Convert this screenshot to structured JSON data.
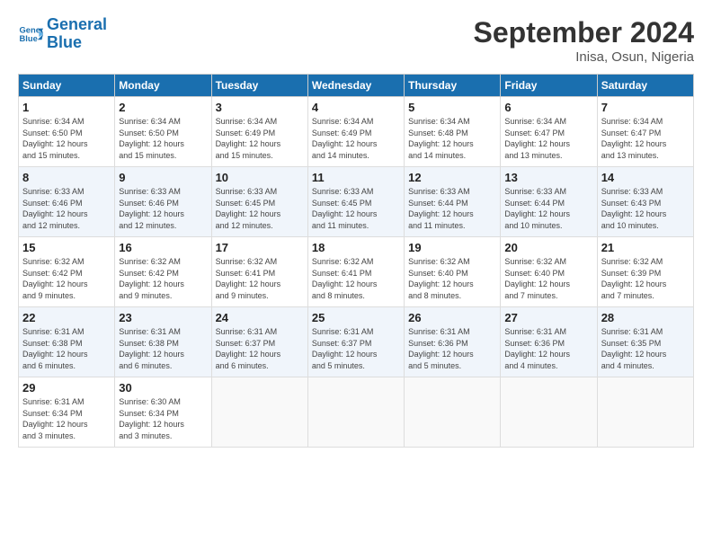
{
  "header": {
    "logo_text_1": "General",
    "logo_text_2": "Blue",
    "month": "September 2024",
    "location": "Inisa, Osun, Nigeria"
  },
  "days_of_week": [
    "Sunday",
    "Monday",
    "Tuesday",
    "Wednesday",
    "Thursday",
    "Friday",
    "Saturday"
  ],
  "weeks": [
    [
      {
        "day": "1",
        "info": "Sunrise: 6:34 AM\nSunset: 6:50 PM\nDaylight: 12 hours\nand 15 minutes."
      },
      {
        "day": "2",
        "info": "Sunrise: 6:34 AM\nSunset: 6:50 PM\nDaylight: 12 hours\nand 15 minutes."
      },
      {
        "day": "3",
        "info": "Sunrise: 6:34 AM\nSunset: 6:49 PM\nDaylight: 12 hours\nand 15 minutes."
      },
      {
        "day": "4",
        "info": "Sunrise: 6:34 AM\nSunset: 6:49 PM\nDaylight: 12 hours\nand 14 minutes."
      },
      {
        "day": "5",
        "info": "Sunrise: 6:34 AM\nSunset: 6:48 PM\nDaylight: 12 hours\nand 14 minutes."
      },
      {
        "day": "6",
        "info": "Sunrise: 6:34 AM\nSunset: 6:47 PM\nDaylight: 12 hours\nand 13 minutes."
      },
      {
        "day": "7",
        "info": "Sunrise: 6:34 AM\nSunset: 6:47 PM\nDaylight: 12 hours\nand 13 minutes."
      }
    ],
    [
      {
        "day": "8",
        "info": "Sunrise: 6:33 AM\nSunset: 6:46 PM\nDaylight: 12 hours\nand 12 minutes."
      },
      {
        "day": "9",
        "info": "Sunrise: 6:33 AM\nSunset: 6:46 PM\nDaylight: 12 hours\nand 12 minutes."
      },
      {
        "day": "10",
        "info": "Sunrise: 6:33 AM\nSunset: 6:45 PM\nDaylight: 12 hours\nand 12 minutes."
      },
      {
        "day": "11",
        "info": "Sunrise: 6:33 AM\nSunset: 6:45 PM\nDaylight: 12 hours\nand 11 minutes."
      },
      {
        "day": "12",
        "info": "Sunrise: 6:33 AM\nSunset: 6:44 PM\nDaylight: 12 hours\nand 11 minutes."
      },
      {
        "day": "13",
        "info": "Sunrise: 6:33 AM\nSunset: 6:44 PM\nDaylight: 12 hours\nand 10 minutes."
      },
      {
        "day": "14",
        "info": "Sunrise: 6:33 AM\nSunset: 6:43 PM\nDaylight: 12 hours\nand 10 minutes."
      }
    ],
    [
      {
        "day": "15",
        "info": "Sunrise: 6:32 AM\nSunset: 6:42 PM\nDaylight: 12 hours\nand 9 minutes."
      },
      {
        "day": "16",
        "info": "Sunrise: 6:32 AM\nSunset: 6:42 PM\nDaylight: 12 hours\nand 9 minutes."
      },
      {
        "day": "17",
        "info": "Sunrise: 6:32 AM\nSunset: 6:41 PM\nDaylight: 12 hours\nand 9 minutes."
      },
      {
        "day": "18",
        "info": "Sunrise: 6:32 AM\nSunset: 6:41 PM\nDaylight: 12 hours\nand 8 minutes."
      },
      {
        "day": "19",
        "info": "Sunrise: 6:32 AM\nSunset: 6:40 PM\nDaylight: 12 hours\nand 8 minutes."
      },
      {
        "day": "20",
        "info": "Sunrise: 6:32 AM\nSunset: 6:40 PM\nDaylight: 12 hours\nand 7 minutes."
      },
      {
        "day": "21",
        "info": "Sunrise: 6:32 AM\nSunset: 6:39 PM\nDaylight: 12 hours\nand 7 minutes."
      }
    ],
    [
      {
        "day": "22",
        "info": "Sunrise: 6:31 AM\nSunset: 6:38 PM\nDaylight: 12 hours\nand 6 minutes."
      },
      {
        "day": "23",
        "info": "Sunrise: 6:31 AM\nSunset: 6:38 PM\nDaylight: 12 hours\nand 6 minutes."
      },
      {
        "day": "24",
        "info": "Sunrise: 6:31 AM\nSunset: 6:37 PM\nDaylight: 12 hours\nand 6 minutes."
      },
      {
        "day": "25",
        "info": "Sunrise: 6:31 AM\nSunset: 6:37 PM\nDaylight: 12 hours\nand 5 minutes."
      },
      {
        "day": "26",
        "info": "Sunrise: 6:31 AM\nSunset: 6:36 PM\nDaylight: 12 hours\nand 5 minutes."
      },
      {
        "day": "27",
        "info": "Sunrise: 6:31 AM\nSunset: 6:36 PM\nDaylight: 12 hours\nand 4 minutes."
      },
      {
        "day": "28",
        "info": "Sunrise: 6:31 AM\nSunset: 6:35 PM\nDaylight: 12 hours\nand 4 minutes."
      }
    ],
    [
      {
        "day": "29",
        "info": "Sunrise: 6:31 AM\nSunset: 6:34 PM\nDaylight: 12 hours\nand 3 minutes."
      },
      {
        "day": "30",
        "info": "Sunrise: 6:30 AM\nSunset: 6:34 PM\nDaylight: 12 hours\nand 3 minutes."
      },
      {
        "day": "",
        "info": ""
      },
      {
        "day": "",
        "info": ""
      },
      {
        "day": "",
        "info": ""
      },
      {
        "day": "",
        "info": ""
      },
      {
        "day": "",
        "info": ""
      }
    ]
  ]
}
